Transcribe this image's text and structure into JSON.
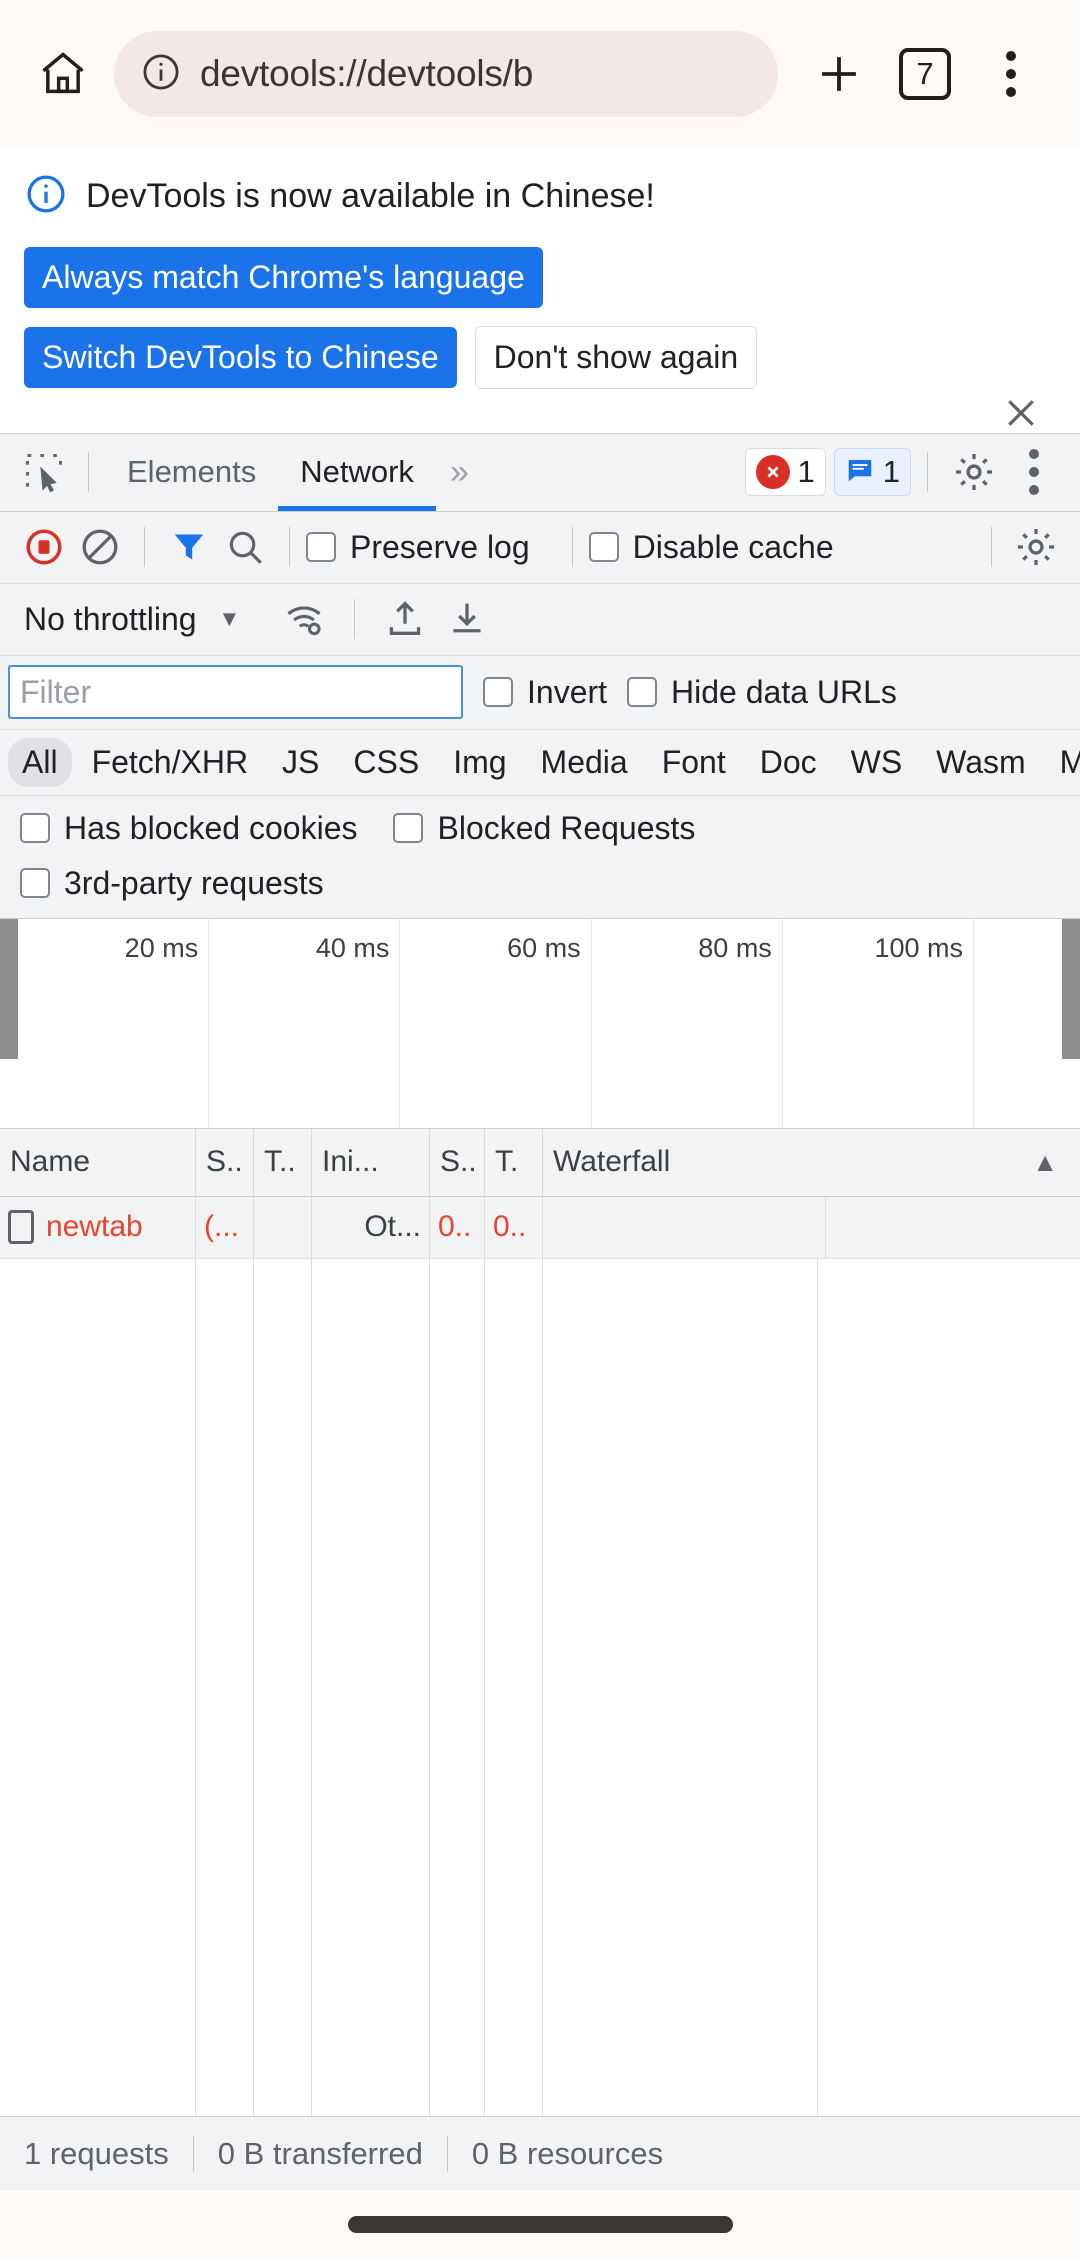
{
  "browser": {
    "home_icon": "home-icon",
    "url": "devtools://devtools/b",
    "info_icon": "info-circle-icon",
    "new_tab_icon": "plus-icon",
    "tab_count": "7",
    "menu_icon": "three-dots-vertical-icon"
  },
  "infobar": {
    "icon": "info-circle-icon",
    "message": "DevTools is now available in Chinese!",
    "primary_button": "Always match Chrome's language",
    "switch_button": "Switch DevTools to Chinese",
    "dismiss_button": "Don't show again",
    "close_icon": "close-icon"
  },
  "devtools_tabs": {
    "inspect_icon": "inspect-element-icon",
    "tabs": [
      {
        "label": "Elements",
        "active": false
      },
      {
        "label": "Network",
        "active": true
      }
    ],
    "overflow": "»",
    "error_count": "1",
    "message_count": "1",
    "error_icon": "error-cross-icon",
    "message_icon": "message-bubble-icon",
    "settings_icon": "gear-icon",
    "more_icon": "three-dots-vertical-icon"
  },
  "network_toolbar": {
    "record_icon": "record-stop-icon",
    "clear_icon": "clear-prohibit-icon",
    "filter_icon": "funnel-filter-icon",
    "search_icon": "search-icon",
    "preserve_log_label": "Preserve log",
    "disable_cache_label": "Disable cache",
    "settings_icon": "gear-icon",
    "throttling_value": "No throttling",
    "throttling_caret": "▼",
    "network_conditions_icon": "wifi-settings-icon",
    "import_har_icon": "import-arrow-up-icon",
    "export_har_icon": "export-arrow-down-icon"
  },
  "filter_bar": {
    "placeholder": "Filter",
    "value": "",
    "invert_label": "Invert",
    "hide_data_urls_label": "Hide data URLs"
  },
  "type_filters": {
    "items": [
      "All",
      "Fetch/XHR",
      "JS",
      "CSS",
      "Img",
      "Media",
      "Font",
      "Doc",
      "WS",
      "Wasm",
      "Man"
    ],
    "selected": "All"
  },
  "extra_filters": {
    "has_blocked_cookies": "Has blocked cookies",
    "blocked_requests": "Blocked Requests",
    "third_party_requests": "3rd-party requests"
  },
  "overview": {
    "ticks": [
      "20 ms",
      "40 ms",
      "60 ms",
      "80 ms",
      "100 ms"
    ]
  },
  "request_table": {
    "columns": [
      "Name",
      "S..",
      "T..",
      "Ini...",
      "S..",
      "T.",
      "Waterfall"
    ],
    "sort_indicator": "▲",
    "rows": [
      {
        "icon": "document-icon",
        "name": "newtab",
        "status": "(...",
        "type": "",
        "initiator": "Ot...",
        "size": "0..",
        "time": "0..",
        "waterfall": ""
      }
    ]
  },
  "status_bar": {
    "requests": "1 requests",
    "transferred": "0 B transferred",
    "resources": "0 B resources"
  },
  "colors": {
    "accent_blue": "#1a73e8",
    "error_red": "#d93025",
    "failed_text": "#e8452c",
    "toolbar_bg": "#f1f3f4",
    "browser_bg": "#fffaf7"
  }
}
